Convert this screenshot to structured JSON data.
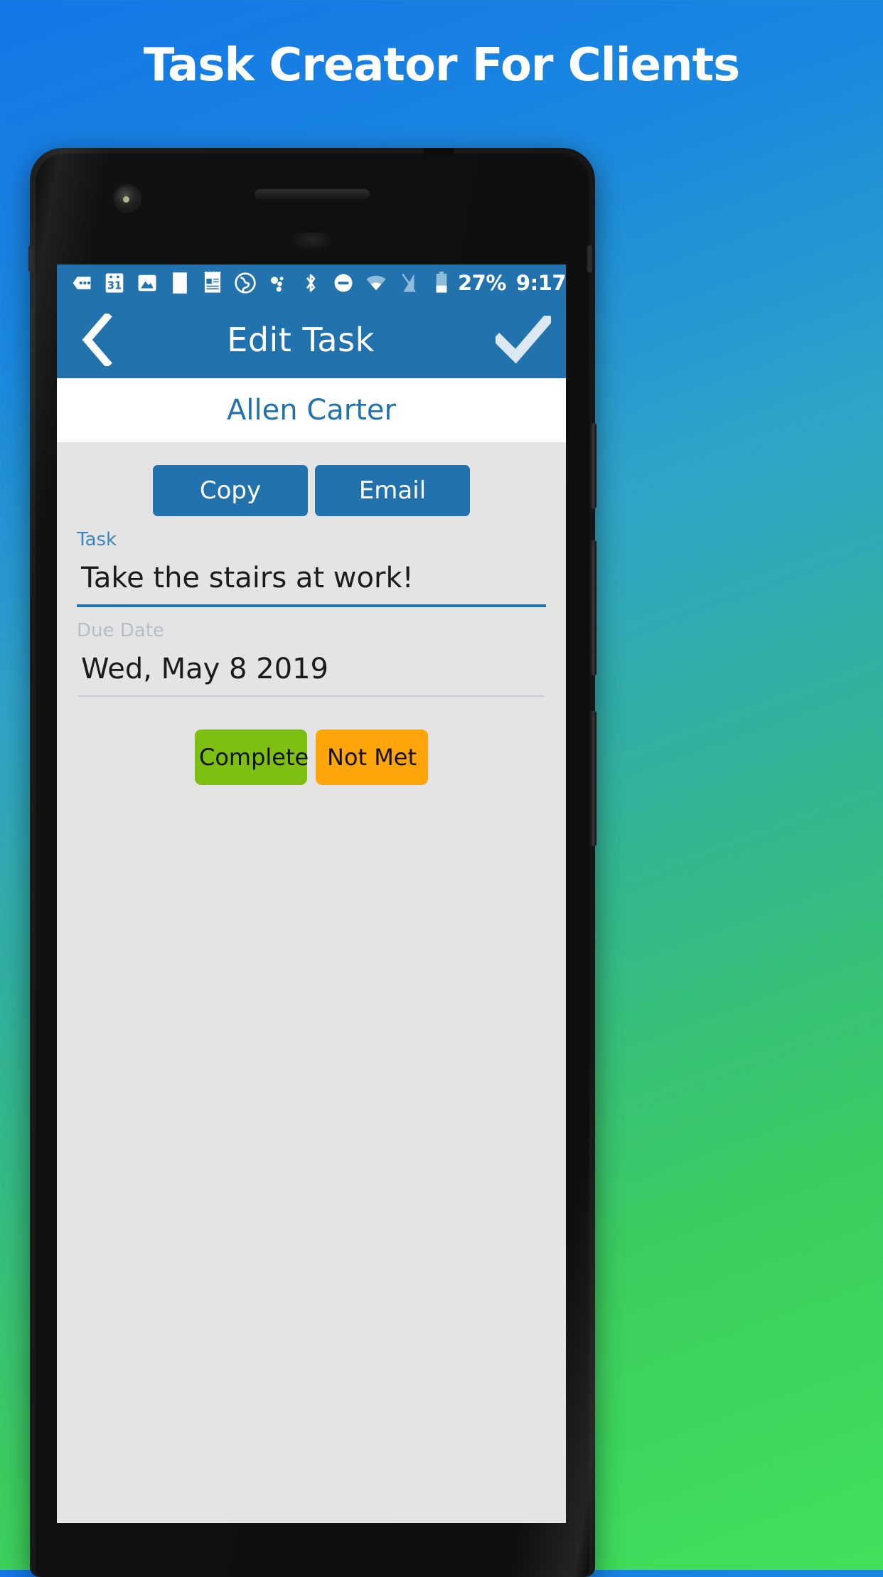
{
  "promo": {
    "headline": "Task Creator For Clients"
  },
  "statusbar": {
    "icons": [
      {
        "name": "messages-icon",
        "glyph": "chat-dots"
      },
      {
        "name": "calendar-icon",
        "glyph": "calendar-31",
        "label": "31"
      },
      {
        "name": "photos-icon",
        "glyph": "image"
      },
      {
        "name": "blank-page-icon",
        "glyph": "page"
      },
      {
        "name": "notepad-icon",
        "glyph": "notepad"
      },
      {
        "name": "globe-icon",
        "glyph": "globe"
      },
      {
        "name": "bubbles-icon",
        "glyph": "bubbles"
      },
      {
        "name": "bluetooth-icon",
        "glyph": "bluetooth"
      },
      {
        "name": "do-not-disturb-icon",
        "glyph": "dnd"
      },
      {
        "name": "wifi-icon",
        "glyph": "wifi"
      },
      {
        "name": "no-signal-icon",
        "glyph": "signal-off"
      },
      {
        "name": "battery-icon",
        "glyph": "battery"
      }
    ],
    "battery_percent": "27%",
    "time": "9:17"
  },
  "appbar": {
    "title": "Edit Task",
    "back_label": "Back",
    "confirm_label": "Save"
  },
  "client": {
    "name": "Allen Carter"
  },
  "actions": {
    "copy_label": "Copy",
    "email_label": "Email"
  },
  "task_field": {
    "label": "Task",
    "value": "Take the stairs at work!"
  },
  "due_date_field": {
    "label": "Due Date",
    "value": "Wed, May 8 2019"
  },
  "status_buttons": {
    "complete_label": "Complete",
    "not_met_label": "Not Met"
  },
  "colors": {
    "brand_blue": "#2272ae",
    "label_blue": "#3d87bd",
    "muted_label": "#b4bec6",
    "complete_green": "#7ec012",
    "not_met_orange": "#ffa50a",
    "screen_bg": "#e4e4e4",
    "bg_gradient_start": "#1476e8",
    "bg_gradient_end": "#41e05a"
  }
}
